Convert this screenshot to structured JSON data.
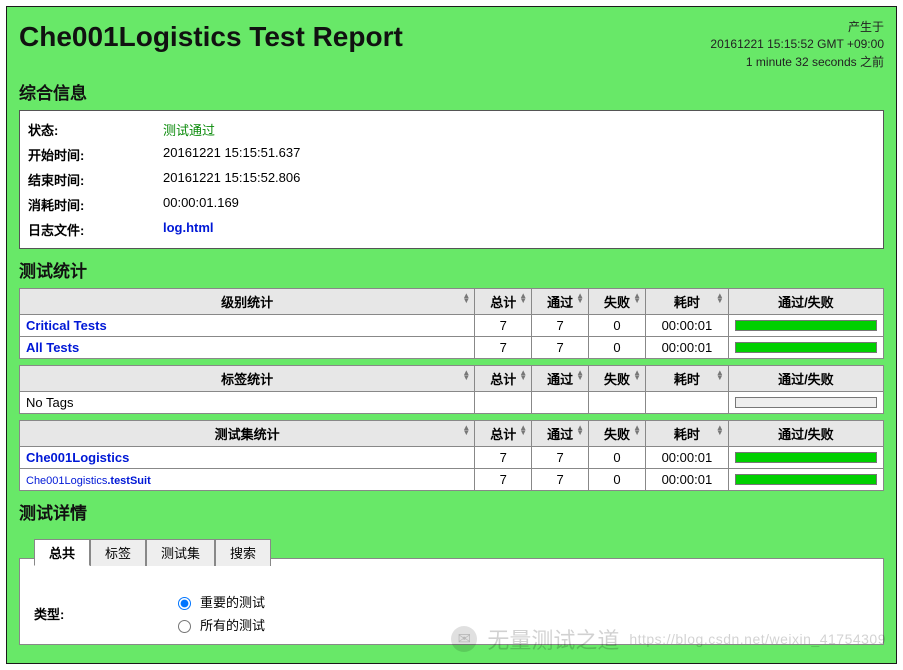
{
  "header": {
    "title": "Che001Logistics Test Report",
    "generated_label": "产生于",
    "generated_time": "20161221 15:15:52 GMT +09:00",
    "generated_ago": "1 minute 32 seconds 之前"
  },
  "sections": {
    "summary_title": "综合信息",
    "stats_title": "测试统计",
    "details_title": "测试详情"
  },
  "summary": {
    "status_label": "状态:",
    "status_value": "测试通过",
    "start_label": "开始时间:",
    "start_value": "20161221 15:15:51.637",
    "end_label": "结束时间:",
    "end_value": "20161221 15:15:52.806",
    "elapsed_label": "消耗时间:",
    "elapsed_value": "00:00:01.169",
    "log_label": "日志文件:",
    "log_value": "log.html"
  },
  "stats_headers": {
    "total": "总计",
    "pass": "通过",
    "fail": "失败",
    "elapsed": "耗时",
    "graph": "通过/失败"
  },
  "stats_level": {
    "title": "级别统计",
    "rows": [
      {
        "name": "Critical Tests",
        "total": "7",
        "pass": "7",
        "fail": "0",
        "elapsed": "00:00:01"
      },
      {
        "name": "All Tests",
        "total": "7",
        "pass": "7",
        "fail": "0",
        "elapsed": "00:00:01"
      }
    ]
  },
  "stats_tag": {
    "title": "标签统计",
    "empty_row": "No Tags"
  },
  "stats_suite": {
    "title": "测试集统计",
    "rows": [
      {
        "name_html": "Che001Logistics",
        "total": "7",
        "pass": "7",
        "fail": "0",
        "elapsed": "00:00:01",
        "bold": true
      },
      {
        "prefix": "Che001Logistics",
        "suffix": ".testSuit",
        "total": "7",
        "pass": "7",
        "fail": "0",
        "elapsed": "00:00:01",
        "bold": false
      }
    ]
  },
  "details": {
    "tabs": {
      "all": "总共",
      "tag": "标签",
      "suite": "测试集",
      "search": "搜索"
    },
    "type_label": "类型:",
    "radio_critical": "重要的测试",
    "radio_all": "所有的测试"
  },
  "watermark": {
    "text": "无量测试之道",
    "url": "https://blog.csdn.net/weixin_41754309"
  }
}
